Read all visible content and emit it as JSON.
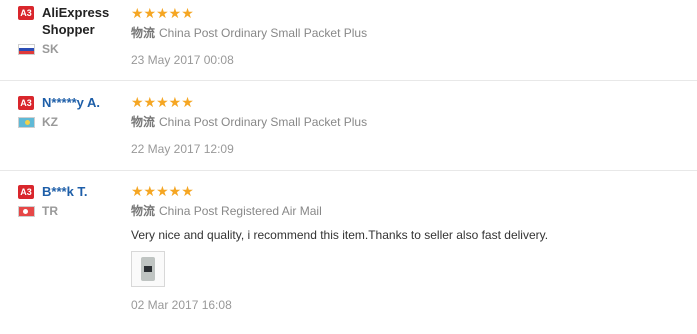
{
  "reviews": [
    {
      "badge": "A3",
      "user_name": "AliExpress Shopper",
      "country": "SK",
      "stars": "★★★★★",
      "shipping_label": "物流",
      "shipping_method": "China Post Ordinary Small Packet Plus",
      "comment": "",
      "date": "23 May 2017 00:08"
    },
    {
      "badge": "A3",
      "user_name": "N*****y A.",
      "country": "KZ",
      "stars": "★★★★★",
      "shipping_label": "物流",
      "shipping_method": "China Post Ordinary Small Packet Plus",
      "comment": "",
      "date": "22 May 2017 12:09"
    },
    {
      "badge": "A3",
      "user_name": "B***k T.",
      "country": "TR",
      "stars": "★★★★★",
      "shipping_label": "物流",
      "shipping_method": "China Post Registered Air Mail",
      "comment": "Very nice and quality, i recommend this item.Thanks to seller also fast delivery.",
      "date": "02 Mar 2017 16:08"
    }
  ],
  "colors": {
    "badge": "#d9262c",
    "star": "#f5a623",
    "link_blue": "#1d5ea8"
  }
}
